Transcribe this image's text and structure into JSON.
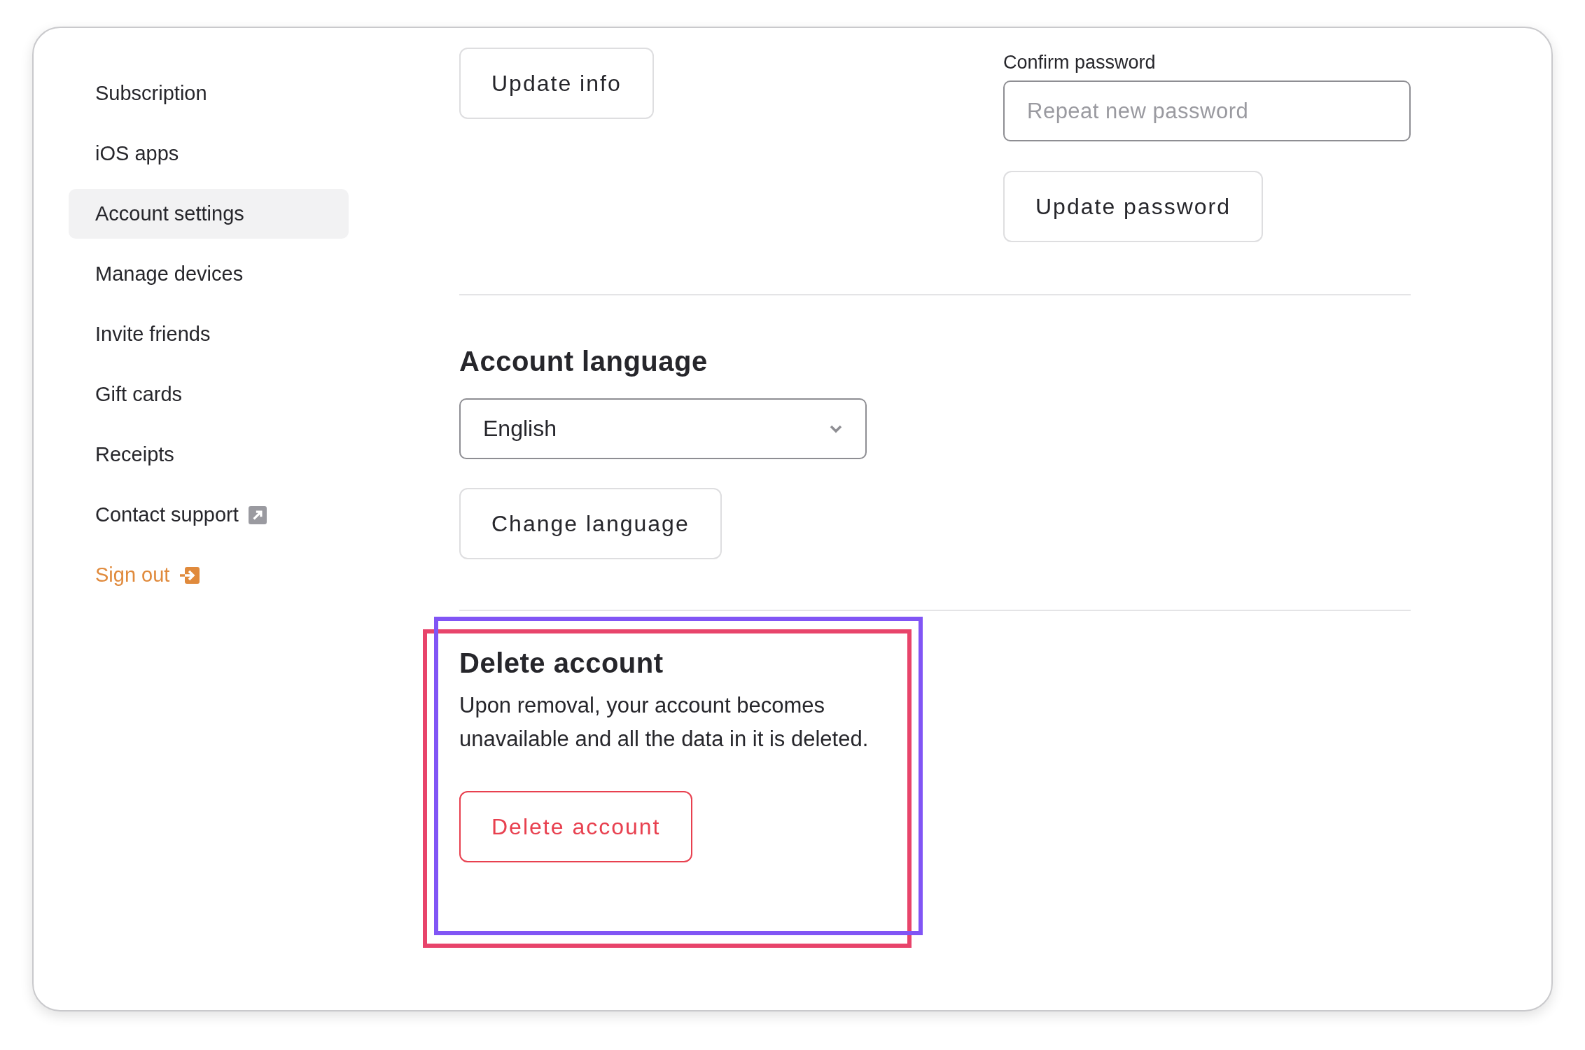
{
  "sidebar": {
    "items": [
      {
        "label": "Subscription",
        "selected": false,
        "kind": "link"
      },
      {
        "label": "iOS apps",
        "selected": false,
        "kind": "link"
      },
      {
        "label": "Account settings",
        "selected": true,
        "kind": "link"
      },
      {
        "label": "Manage devices",
        "selected": false,
        "kind": "link"
      },
      {
        "label": "Invite friends",
        "selected": false,
        "kind": "link"
      },
      {
        "label": "Gift cards",
        "selected": false,
        "kind": "link"
      },
      {
        "label": "Receipts",
        "selected": false,
        "kind": "link"
      },
      {
        "label": "Contact support",
        "selected": false,
        "kind": "external"
      },
      {
        "label": "Sign out",
        "selected": false,
        "kind": "signout"
      }
    ]
  },
  "profile": {
    "button": "Update info"
  },
  "password": {
    "label": "Confirm password",
    "placeholder": "Repeat new password",
    "button": "Update password"
  },
  "language": {
    "heading": "Account language",
    "value": "English",
    "button": "Change language"
  },
  "delete_account": {
    "heading": "Delete account",
    "description": "Upon removal, your account becomes unavailable and all the data in it is deleted.",
    "button": "Delete account"
  },
  "highlights": [
    {
      "color": "#e8446b"
    },
    {
      "color": "#8155f5"
    }
  ]
}
